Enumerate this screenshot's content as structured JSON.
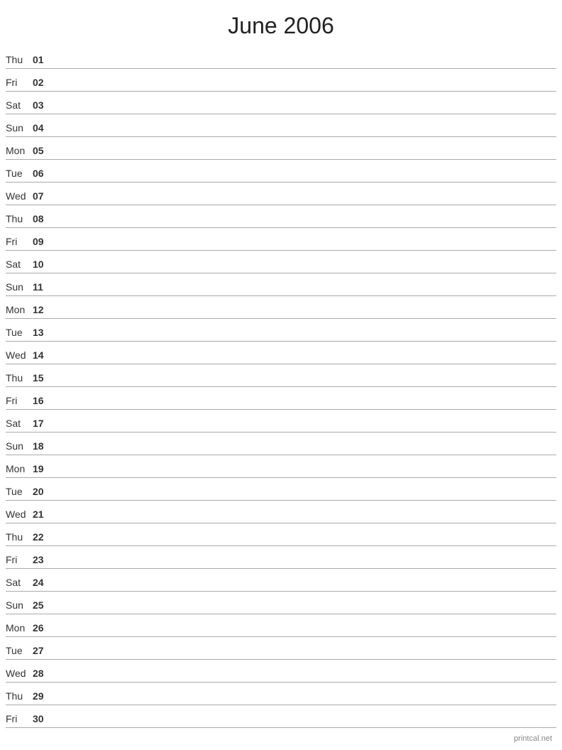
{
  "header": {
    "title": "June 2006"
  },
  "days": [
    {
      "name": "Thu",
      "number": "01"
    },
    {
      "name": "Fri",
      "number": "02"
    },
    {
      "name": "Sat",
      "number": "03"
    },
    {
      "name": "Sun",
      "number": "04"
    },
    {
      "name": "Mon",
      "number": "05"
    },
    {
      "name": "Tue",
      "number": "06"
    },
    {
      "name": "Wed",
      "number": "07"
    },
    {
      "name": "Thu",
      "number": "08"
    },
    {
      "name": "Fri",
      "number": "09"
    },
    {
      "name": "Sat",
      "number": "10"
    },
    {
      "name": "Sun",
      "number": "11"
    },
    {
      "name": "Mon",
      "number": "12"
    },
    {
      "name": "Tue",
      "number": "13"
    },
    {
      "name": "Wed",
      "number": "14"
    },
    {
      "name": "Thu",
      "number": "15"
    },
    {
      "name": "Fri",
      "number": "16"
    },
    {
      "name": "Sat",
      "number": "17"
    },
    {
      "name": "Sun",
      "number": "18"
    },
    {
      "name": "Mon",
      "number": "19"
    },
    {
      "name": "Tue",
      "number": "20"
    },
    {
      "name": "Wed",
      "number": "21"
    },
    {
      "name": "Thu",
      "number": "22"
    },
    {
      "name": "Fri",
      "number": "23"
    },
    {
      "name": "Sat",
      "number": "24"
    },
    {
      "name": "Sun",
      "number": "25"
    },
    {
      "name": "Mon",
      "number": "26"
    },
    {
      "name": "Tue",
      "number": "27"
    },
    {
      "name": "Wed",
      "number": "28"
    },
    {
      "name": "Thu",
      "number": "29"
    },
    {
      "name": "Fri",
      "number": "30"
    }
  ],
  "footer": {
    "text": "printcal.net"
  }
}
